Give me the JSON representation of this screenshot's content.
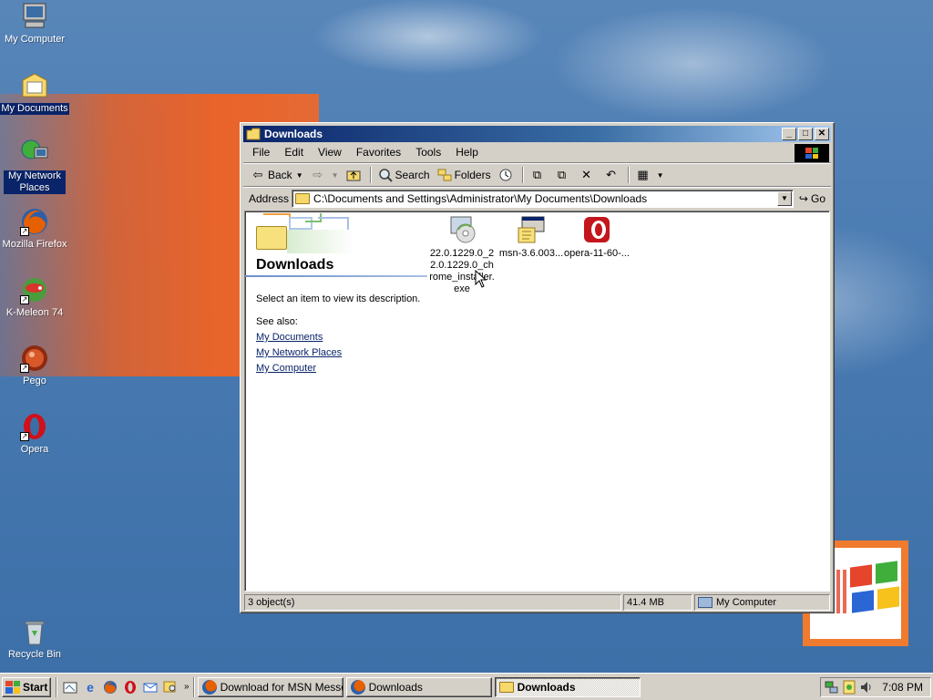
{
  "desktop": {
    "icons": [
      {
        "label": "My Computer",
        "icon": "my-computer-icon"
      },
      {
        "label": "My Documents",
        "icon": "my-documents-icon"
      },
      {
        "label": "My Network Places",
        "icon": "network-places-icon"
      },
      {
        "label": "Mozilla Firefox",
        "icon": "firefox-icon"
      },
      {
        "label": "K-Meleon 74",
        "icon": "k-meleon-icon"
      },
      {
        "label": "Pego",
        "icon": "pego-icon"
      },
      {
        "label": "Opera",
        "icon": "opera-icon"
      },
      {
        "label": "Recycle Bin",
        "icon": "recycle-bin-icon"
      }
    ]
  },
  "window": {
    "title": "Downloads",
    "controls": {
      "minimize": "_",
      "maximize": "□",
      "close": "✕"
    },
    "menu": [
      "File",
      "Edit",
      "View",
      "Favorites",
      "Tools",
      "Help"
    ],
    "toolbar": {
      "back": "Back",
      "search": "Search",
      "folders": "Folders"
    },
    "address": {
      "label": "Address",
      "value": "C:\\Documents and Settings\\Administrator\\My Documents\\Downloads",
      "go": "Go"
    },
    "pane": {
      "title": "Downloads",
      "description": "Select an item to view its description.",
      "see_also": "See also:",
      "links": [
        "My Documents",
        "My Network Places",
        "My Computer"
      ]
    },
    "files": [
      {
        "name": "22.0.1229.0_22.0.1229.0_chrome_installer.exe",
        "display": "22.0.1229.0_2 2.0.1229.0_ch rome_installer. exe",
        "icon": "installer-cd-icon"
      },
      {
        "name": "msn-3.6.003...",
        "display": "msn-3.6.003...",
        "icon": "setup-program-icon"
      },
      {
        "name": "opera-11-60-...",
        "display": "opera-11-60-...",
        "icon": "opera-installer-icon"
      }
    ],
    "status": {
      "objects": "3 object(s)",
      "size": "41.4 MB",
      "zone": "My Computer"
    }
  },
  "taskbar": {
    "start": "Start",
    "tasks": [
      {
        "label": "Download for MSN Messe...",
        "active": false,
        "icon": "firefox-icon"
      },
      {
        "label": "Downloads",
        "active": false,
        "icon": "firefox-icon"
      },
      {
        "label": "Downloads",
        "active": true,
        "icon": "folder-icon"
      }
    ],
    "clock": "7:08 PM"
  },
  "colors": {
    "titlebar": "#0a246a",
    "desktop": "#3a6ea5",
    "face": "#d4d0c8",
    "link": "#0a246a"
  }
}
